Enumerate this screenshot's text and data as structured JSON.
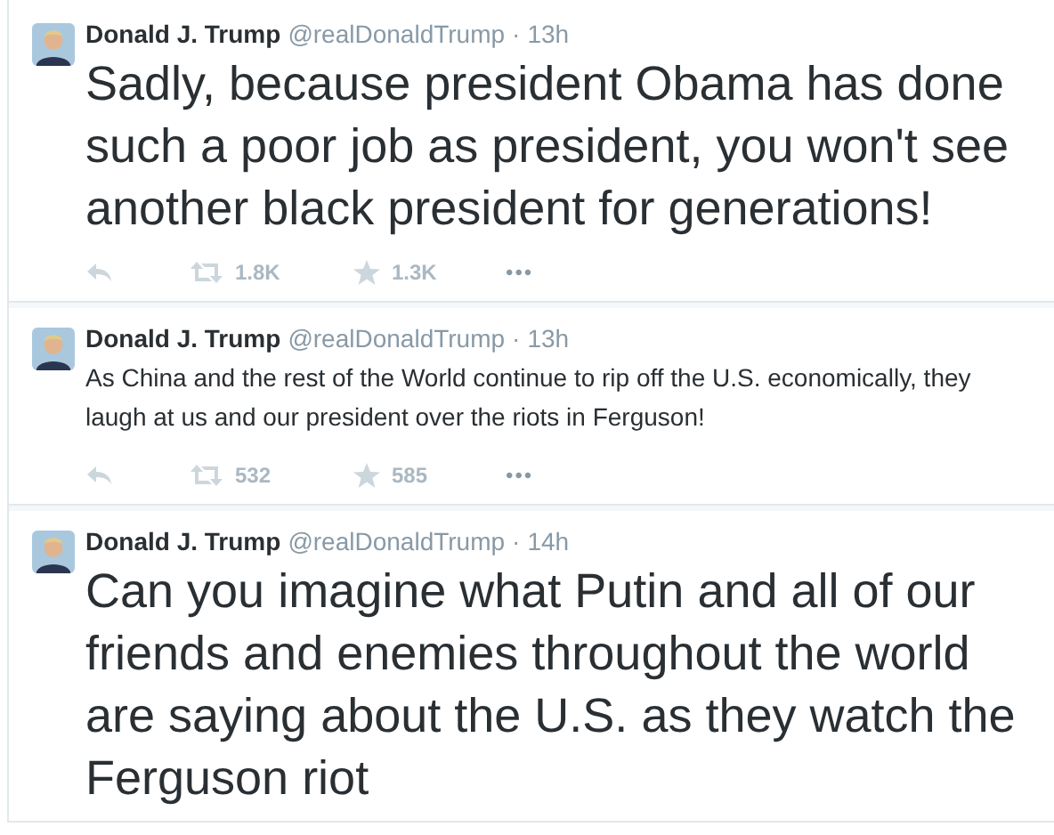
{
  "tweets": [
    {
      "name": "Donald J. Trump",
      "handle": "@realDonaldTrump",
      "separator": "·",
      "time": "13h",
      "kind": "large",
      "text": "Sadly, because president Obama has done such a poor job as president, you won't see another black president for generations!",
      "actions": {
        "retweets": "1.8K",
        "favorites": "1.3K",
        "more": "•••"
      }
    },
    {
      "name": "Donald J. Trump",
      "handle": "@realDonaldTrump",
      "separator": "·",
      "time": "13h",
      "kind": "normal",
      "text": "As China and the rest of the World continue to rip off the U.S. economically, they laugh at us and our president over the riots in Ferguson!",
      "actions": {
        "retweets": "532",
        "favorites": "585",
        "more": "•••"
      }
    },
    {
      "name": "Donald J. Trump",
      "handle": "@realDonaldTrump",
      "separator": "·",
      "time": "14h",
      "kind": "large",
      "text": "Can you imagine what Putin and all of our friends and enemies throughout the world are saying about the U.S. as they watch the Ferguson riot"
    }
  ]
}
